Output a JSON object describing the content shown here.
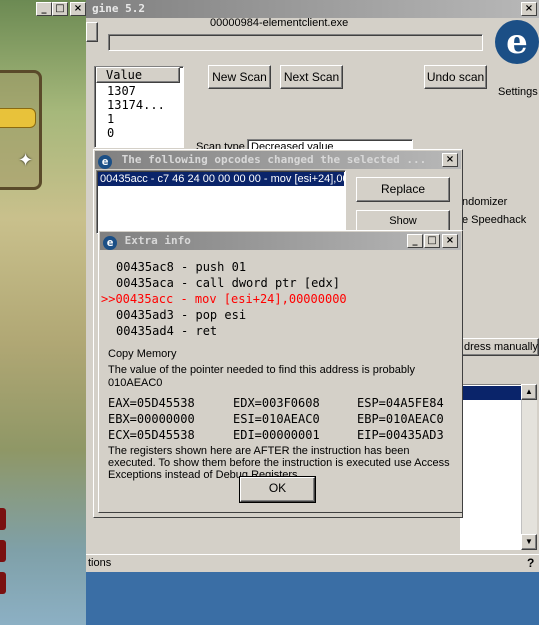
{
  "game": {
    "title_fragment": "gine 5.2"
  },
  "ce_main": {
    "process_name": "00000984-elementclient.exe",
    "list_header": "Value",
    "values": [
      "1307",
      "13174...",
      "1",
      "0"
    ],
    "new_scan": "New Scan",
    "next_scan": "Next Scan",
    "undo_scan": "Undo scan",
    "settings": "Settings",
    "scan_type_label": "Scan type",
    "scan_type_value": "Decreased value",
    "randomizer": "ndomizer",
    "speedhack": "e Speedhack",
    "add_manually": "dress manually",
    "bottom_left": "tions",
    "help": "?"
  },
  "opcodes_dialog": {
    "title": "The following opcodes changed the selected ...",
    "entry": "00435acc - c7 46 24 00 00 00 00 - mov [esi+24],00",
    "replace": "Replace",
    "show_disassembler": "Show disassembler"
  },
  "extra_info": {
    "title": "Extra info",
    "code_lines": [
      "00435ac8 - push 01",
      "00435aca - call dword ptr [edx]",
      ">>00435acc - mov [esi+24],00000000",
      "00435ad3 - pop esi",
      "00435ad4 - ret"
    ],
    "copy_memory": "Copy Memory",
    "pointer_text": "The value of the pointer needed to find this address is probably",
    "pointer_value": "010AEAC0",
    "registers": [
      [
        "EAX=05D45538",
        "EDX=003F0608",
        "ESP=04A5FE84"
      ],
      [
        "EBX=00000000",
        "ESI=010AEAC0",
        "EBP=010AEAC0"
      ],
      [
        "ECX=05D45538",
        "EDI=00000001",
        "EIP=00435AD3"
      ]
    ],
    "note": "The registers shown here are AFTER the instruction has been executed. To show them before the instruction is executed use Access Exceptions instead of Debug Registers",
    "ok": "OK"
  },
  "colors": {
    "highlight_code": "#ff0000",
    "selection": "#0a246a",
    "face": "#d4d0c8"
  }
}
